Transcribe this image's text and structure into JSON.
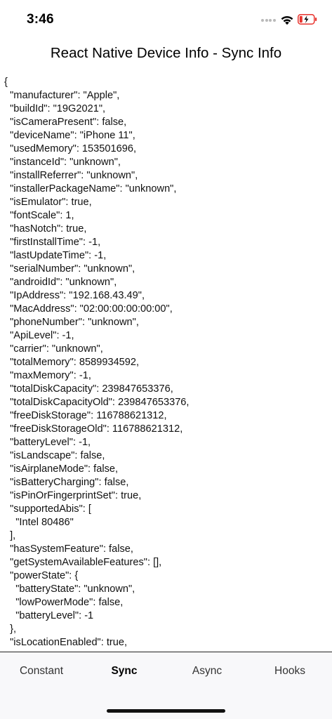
{
  "status_bar": {
    "time": "3:46",
    "icons": [
      "signal-dots-icon",
      "wifi-icon",
      "battery-charging-icon"
    ]
  },
  "header": {
    "title": "React Native Device Info - Sync Info"
  },
  "json_lines": [
    "{",
    "  \"manufacturer\": \"Apple\",",
    "  \"buildId\": \"19G2021\",",
    "  \"isCameraPresent\": false,",
    "  \"deviceName\": \"iPhone 11\",",
    "  \"usedMemory\": 153501696,",
    "  \"instanceId\": \"unknown\",",
    "  \"installReferrer\": \"unknown\",",
    "  \"installerPackageName\": \"unknown\",",
    "  \"isEmulator\": true,",
    "  \"fontScale\": 1,",
    "  \"hasNotch\": true,",
    "  \"firstInstallTime\": -1,",
    "  \"lastUpdateTime\": -1,",
    "  \"serialNumber\": \"unknown\",",
    "  \"androidId\": \"unknown\",",
    "  \"IpAddress\": \"192.168.43.49\",",
    "  \"MacAddress\": \"02:00:00:00:00:00\",",
    "  \"phoneNumber\": \"unknown\",",
    "  \"ApiLevel\": -1,",
    "  \"carrier\": \"unknown\",",
    "  \"totalMemory\": 8589934592,",
    "  \"maxMemory\": -1,",
    "  \"totalDiskCapacity\": 239847653376,",
    "  \"totalDiskCapacityOld\": 239847653376,",
    "  \"freeDiskStorage\": 116788621312,",
    "  \"freeDiskStorageOld\": 116788621312,",
    "  \"batteryLevel\": -1,",
    "  \"isLandscape\": false,",
    "  \"isAirplaneMode\": false,",
    "  \"isBatteryCharging\": false,",
    "  \"isPinOrFingerprintSet\": true,",
    "  \"supportedAbis\": [",
    "    \"Intel 80486\"",
    "  ],",
    "  \"hasSystemFeature\": false,",
    "  \"getSystemAvailableFeatures\": [],",
    "  \"powerState\": {",
    "    \"batteryState\": \"unknown\",",
    "    \"lowPowerMode\": false,",
    "    \"batteryLevel\": -1",
    "  },",
    "  \"isLocationEnabled\": true,"
  ],
  "tabs": [
    {
      "label": "Constant",
      "active": false
    },
    {
      "label": "Sync",
      "active": true
    },
    {
      "label": "Async",
      "active": false
    },
    {
      "label": "Hooks",
      "active": false
    }
  ],
  "colors": {
    "battery_charging": "#e8332d",
    "tab_bar_background": "#f8f8fa"
  }
}
